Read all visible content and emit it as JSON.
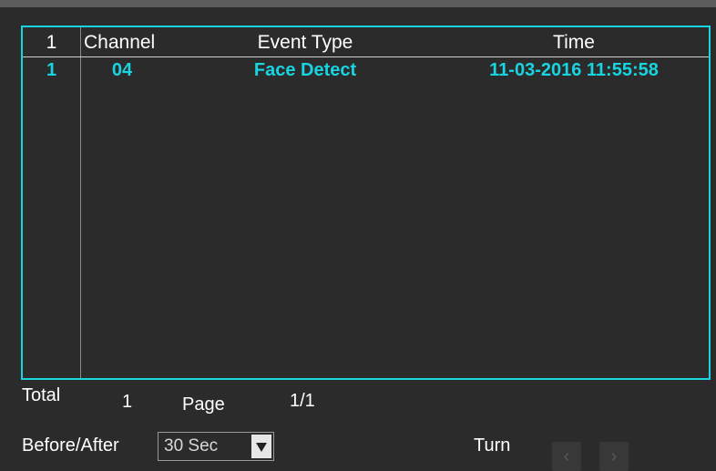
{
  "table": {
    "headers": {
      "index": "1",
      "channel": "Channel",
      "event_type": "Event Type",
      "time": "Time"
    },
    "rows": [
      {
        "index": "1",
        "channel": "04",
        "event_type": "Face Detect",
        "time": "11-03-2016 11:55:58"
      }
    ]
  },
  "footer": {
    "total_label": "Total",
    "total_value": "1",
    "page_label": "Page",
    "page_value": "1/1",
    "before_after_label": "Before/After",
    "before_after_value": "30 Sec",
    "turn_label": "Turn",
    "prev_icon": "chevron-left-icon",
    "next_icon": "chevron-right-icon"
  },
  "colors": {
    "accent": "#17d4e0",
    "background": "#2b2b2b"
  }
}
